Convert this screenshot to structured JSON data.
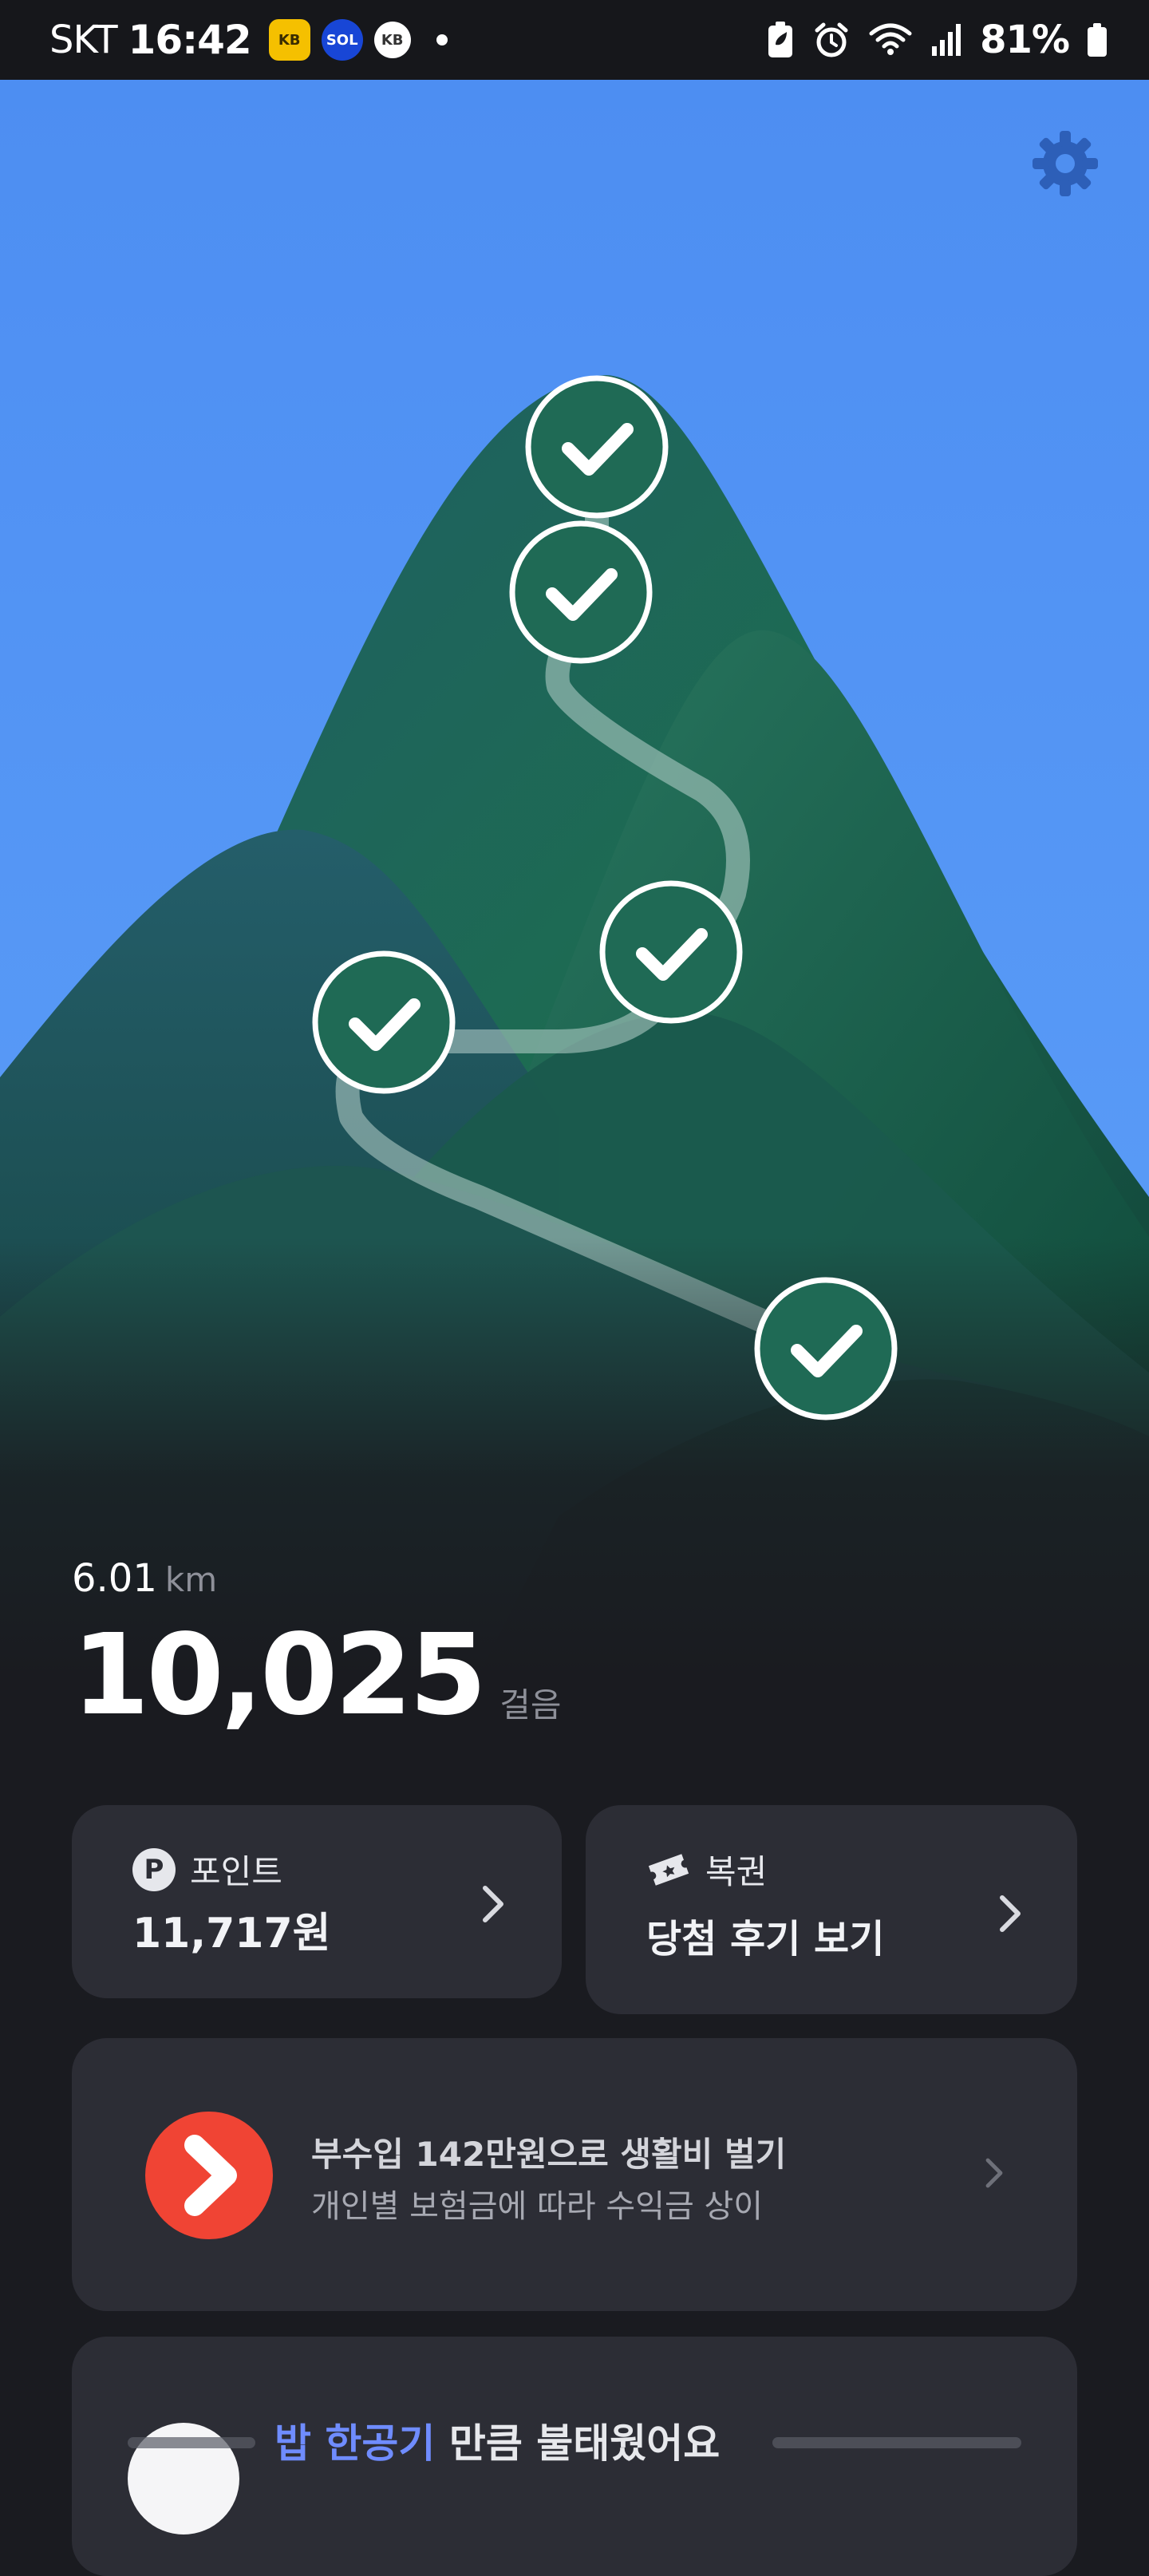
{
  "status_bar": {
    "carrier": "SKT",
    "time": "16:42",
    "battery_percent": "81%",
    "icons": [
      "kb-bank-app-icon",
      "super-sol-app-icon",
      "kb-app-icon",
      "notification-dot-icon",
      "battery-saver-icon",
      "alarm-icon",
      "wifi-icon",
      "signal-icon",
      "battery-icon"
    ]
  },
  "header": {
    "settings_icon": "gear-icon"
  },
  "hero": {
    "checkpoints_completed": 5,
    "colors": {
      "sky": "#4f8ff0",
      "mountain": "#1f5a48",
      "check_circle": "#1f6a55"
    }
  },
  "stats": {
    "distance_value": "6.01",
    "distance_unit": "km",
    "steps_value": "10,025",
    "steps_unit": "걸음"
  },
  "cards": {
    "points": {
      "icon": "P",
      "label": "포인트",
      "value": "11,717원"
    },
    "lottery": {
      "icon": "ticket-icon",
      "label": "복권",
      "value": "당첨 후기 보기"
    },
    "ad": {
      "title": "부수입 142만원으로 생활비 벌기",
      "subtitle": "개인별 보험금에 따라 수익금 상이",
      "brand_color": "#f04434"
    },
    "calories": {
      "highlight": "밥 한공기",
      "rest": " 만큼 불태웠어요"
    }
  }
}
